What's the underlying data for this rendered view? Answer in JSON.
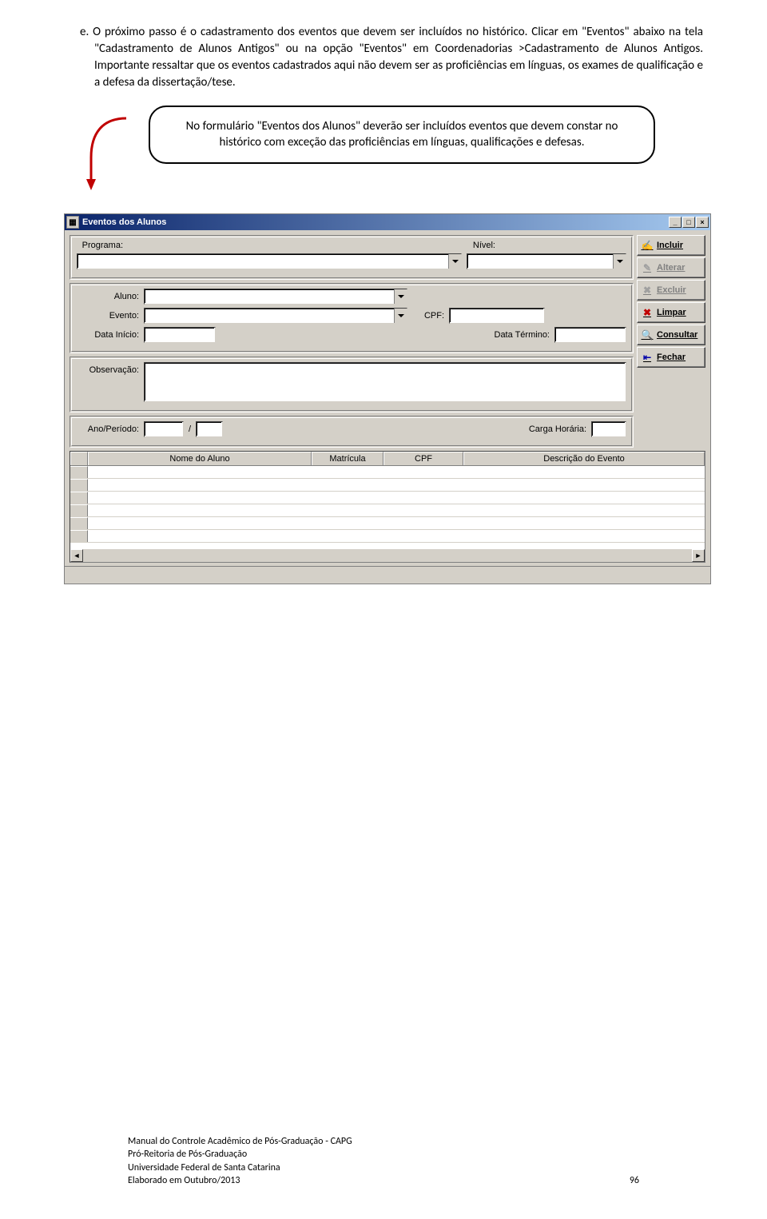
{
  "list_marker": "e.",
  "para1_a": "O próximo passo é o cadastramento dos eventos que devem ser incluídos no histórico.  Clicar em \"Eventos\"  abaixo  na  tela  \"Cadastramento  de  Alunos  Antigos\"  ou  na  opção  \"Eventos\"  em Coordenadorias  >Cadastramento  de  Alunos  Antigos.  Importante  ressaltar  que  os  eventos cadastrados aqui não devem ser as proficiências em línguas, os exames de qualificação e a defesa da dissertação/tese.",
  "callout": "No formulário \"Eventos dos Alunos\" deverão ser incluídos eventos que devem constar no histórico com exceção das proficiências em línguas, qualificações e defesas.",
  "window": {
    "title": "Eventos dos Alunos",
    "labels": {
      "programa": "Programa:",
      "nivel": "Nível:",
      "aluno": "Aluno:",
      "evento": "Evento:",
      "cpf": "CPF:",
      "data_inicio": "Data Início:",
      "data_termino": "Data Término:",
      "observacao": "Observação:",
      "ano_periodo": "Ano/Período:",
      "barra": "/",
      "carga_horaria": "Carga Horária:"
    },
    "buttons": {
      "incluir": "Incluir",
      "alterar": "Alterar",
      "excluir": "Excluir",
      "limpar": "Limpar",
      "consultar": "Consultar",
      "fechar": "Fechar"
    },
    "grid_headers": {
      "nome": "Nome do Aluno",
      "matricula": "Matrícula",
      "cpf": "CPF",
      "descricao": "Descrição do Evento"
    }
  },
  "footer": {
    "l1": "Manual do Controle Acadêmico de Pós-Graduação - CAPG",
    "l2": "Pró-Reitoria de Pós-Graduação",
    "l3": "Universidade Federal de Santa Catarina",
    "l4": "Elaborado em Outubro/2013",
    "page": "96"
  }
}
